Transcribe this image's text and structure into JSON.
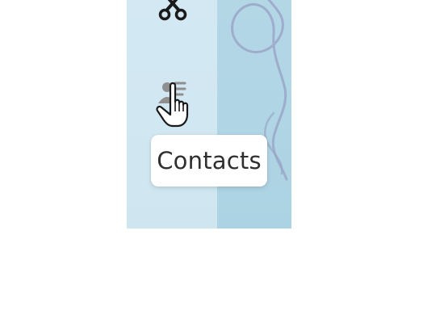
{
  "tooltip": {
    "text": "Contacts"
  },
  "sidebar": {
    "items": [
      {
        "icon": "scissors-icon"
      },
      {
        "icon": "contacts-icon"
      }
    ]
  },
  "cursor": {
    "icon": "hand-pointer-icon"
  },
  "colors": {
    "sidebar_background": "#d3e8f2",
    "wallpaper_background": "#b4d7e6",
    "wallpaper_line": "#9aa6c8",
    "tooltip_background": "#ffffff",
    "tooltip_text": "#2f2f2f"
  }
}
